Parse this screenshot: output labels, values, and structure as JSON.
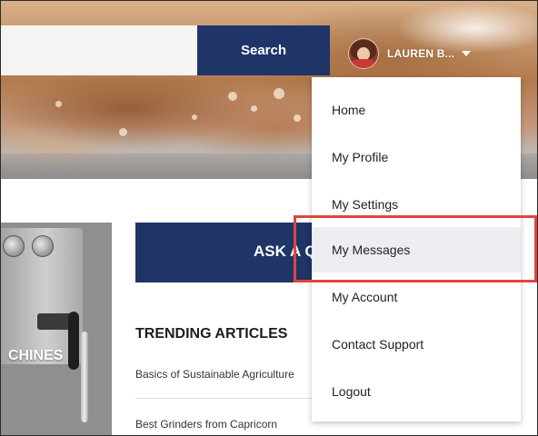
{
  "header": {
    "search": {
      "placeholder": "",
      "value": "",
      "button_label": "Search"
    },
    "user": {
      "name": "LAUREN B...",
      "avatar_icon": "avatar-photo",
      "caret_icon": "caret-down-icon"
    }
  },
  "user_menu": {
    "items": [
      {
        "label": "Home"
      },
      {
        "label": "My Profile"
      },
      {
        "label": "My Settings"
      },
      {
        "label": "My Messages",
        "highlighted": true
      },
      {
        "label": "My Account"
      },
      {
        "label": "Contact Support"
      },
      {
        "label": "Logout"
      }
    ],
    "highlight_color": "#e0453e"
  },
  "main": {
    "category_tile": {
      "label": "CHINES"
    },
    "ask_button": {
      "label": "ASK A QUESTION"
    },
    "trending": {
      "title": "TRENDING ARTICLES",
      "articles": [
        {
          "title": "Basics of Sustainable Agriculture"
        },
        {
          "title": "Best Grinders from Capricorn"
        }
      ]
    }
  },
  "colors": {
    "brand_navy": "#1f3467",
    "menu_active_bg": "#eceef2"
  }
}
